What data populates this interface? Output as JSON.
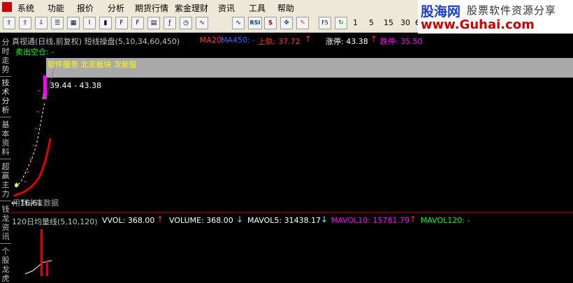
{
  "menu": {
    "items": [
      "系统",
      "功能",
      "报价",
      "分析",
      "期货行情",
      "紫金理财",
      "资讯",
      "工具",
      "帮助"
    ]
  },
  "toolbar": {
    "icons": [
      "arrow-up-icon",
      "arrow-up-icon",
      "arrow-down-icon",
      "list-icon",
      "grid-icon",
      "line-chart-icon",
      "candle-icon",
      "f10-icon",
      "f12-icon",
      "doc-icon",
      "fx-icon",
      "clock-icon",
      "trend-icon",
      "rsi-icon",
      "dollar-icon",
      "move-icon",
      "pencil-icon",
      "f5-icon",
      "refresh-icon"
    ],
    "rsi_label": "RSI",
    "f5_label": "F5",
    "periods": [
      "1",
      "5",
      "15",
      "30",
      "6"
    ]
  },
  "brand": {
    "name": "股海网",
    "slogan": "股票软件资源分享",
    "url": "www.Guhai.com"
  },
  "side_tabs": [
    "分时走势",
    "技术分析",
    "基本资料",
    "超赢主力",
    "钱龙资讯",
    "个股龙虎"
  ],
  "chart_header": {
    "title": "真视通(日线,前复权) 短线操盘(5,10,34,60,450)",
    "ma20": "MA20: -",
    "ma450": "MA450: -",
    "upper_rail": "上轨: 37.72",
    "limit_up": "涨停: 43.38",
    "limit_down": "跌停: 35.50"
  },
  "annotation": {
    "sell_signal": "卖出空仓: -",
    "concept": "软件服务 北京板块 次新股",
    "price_range": "39.44 - 43.38",
    "low_price": "← 16.61",
    "future_data": "用到未来数据"
  },
  "volume_header": {
    "title": "120日均量线(5,10,120)",
    "vvol": "VVOL: 368.00",
    "volume": "VOLUME: 368.00",
    "mavol5": "MAVOL5: 31438.17",
    "mavol10": "MAVOL10: 15781.79",
    "mavol120": "MAVOL120: -"
  },
  "colors": {
    "up": "#ff3232",
    "down": "#54ffff",
    "ma_blue": "#3060ff",
    "magenta": "#ff00ff",
    "yellow": "#ffff00",
    "green": "#00ff00",
    "white": "#ffffff"
  }
}
